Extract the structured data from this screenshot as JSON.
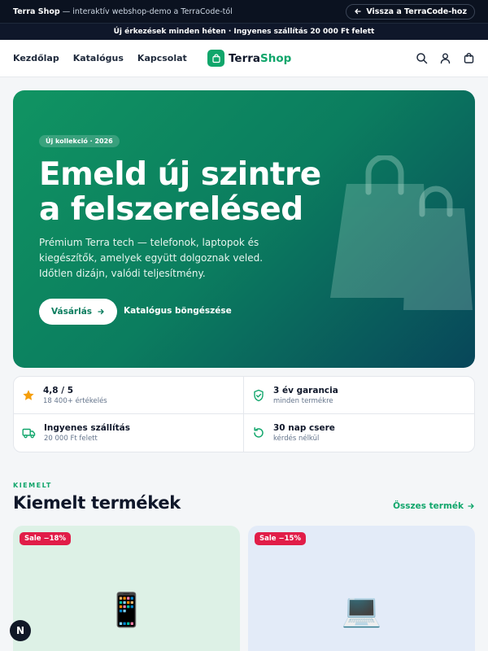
{
  "topbar": {
    "brand": "Terra Shop",
    "tagline": "— interaktív webshop-demo a TerraCode-tól",
    "back_label": "Vissza a TerraCode-hoz"
  },
  "promo": {
    "text": "Új érkezések minden héten · Ingyenes szállítás 20 000 Ft felett"
  },
  "nav": {
    "links": [
      "Kezdőlap",
      "Katalógus",
      "Kapcsolat"
    ],
    "logo_terra": "Terra",
    "logo_shop": "Shop",
    "icons": [
      "search-icon",
      "user-icon",
      "cart-icon"
    ]
  },
  "hero": {
    "tag": "Új kollekció · 2026",
    "title_line1": "Emeld új szintre",
    "title_line2": "a felszerelésed",
    "description": "Prémium Terra tech — telefonok, laptopok és kiegészítők, amelyek együtt dolgoznak veled. Időtlen dizájn, valódi teljesítmény.",
    "shop_button": "Vásárlás",
    "browse_link": "Katalógus böngészése",
    "colors": {
      "start": "#109462",
      "end": "#08465a"
    }
  },
  "stats": [
    {
      "title": "4,8 / 5",
      "sub": "18 400+ értékelés",
      "icon": "star-icon"
    },
    {
      "title": "3 év garancia",
      "sub": "minden termékre",
      "icon": "shield-check-icon"
    },
    {
      "title": "Ingyenes szállítás",
      "sub": "20 000 Ft felett",
      "icon": "truck-icon"
    },
    {
      "title": "30 nap csere",
      "sub": "kérdés nélkül",
      "icon": "rotate-icon"
    }
  ],
  "featured": {
    "kicker": "KIEMELT",
    "title": "Kiemelt termékek",
    "all_link": "Összes termék",
    "products": [
      {
        "badge": "Sale −18%",
        "emoji": "📱"
      },
      {
        "badge": "Sale −15%",
        "emoji": "💻"
      }
    ]
  },
  "floating": {
    "label": "N"
  },
  "colors": {
    "accent": "#10a66b",
    "dark": "#0f172a",
    "sale": "#e11d48"
  }
}
